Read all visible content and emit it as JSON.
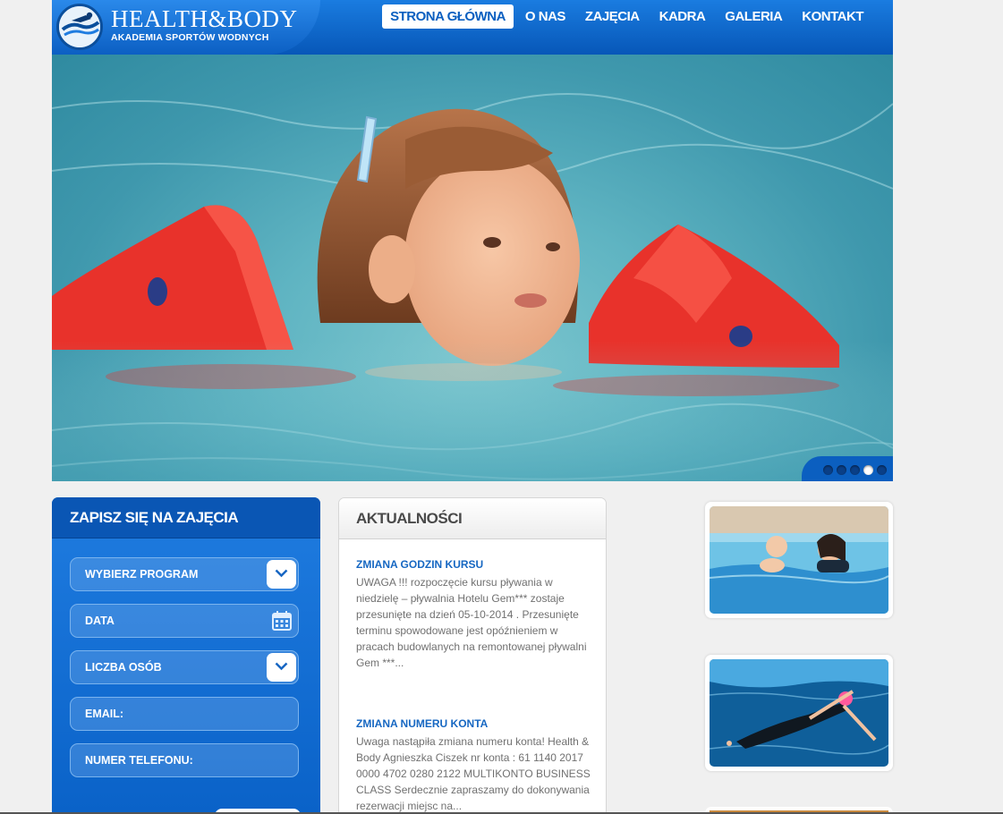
{
  "brand": {
    "title": "HEALTH&BODY",
    "subtitle": "AKADEMIA SPORTÓW WODNYCH"
  },
  "nav": {
    "items": [
      {
        "label": "STRONA GŁÓWNA",
        "active": true
      },
      {
        "label": "O NAS",
        "active": false
      },
      {
        "label": "ZAJĘCIA",
        "active": false
      },
      {
        "label": "KADRA",
        "active": false
      },
      {
        "label": "GALERIA",
        "active": false
      },
      {
        "label": "KONTAKT",
        "active": false
      }
    ]
  },
  "slider": {
    "slide_count": 5,
    "active_slide": 4
  },
  "signup": {
    "title": "ZAPISZ SIĘ NA ZAJĘCIA",
    "fields": [
      {
        "label": "WYBIERZ PROGRAM",
        "control": "dropdown"
      },
      {
        "label": "DATA",
        "control": "calendar"
      },
      {
        "label": "LICZBA OSÓB",
        "control": "dropdown"
      },
      {
        "label": "EMAIL:",
        "control": "text"
      },
      {
        "label": "NUMER TELEFONU:",
        "control": "text"
      }
    ]
  },
  "news": {
    "title": "AKTUALNOŚCI",
    "items": [
      {
        "title": "ZMIANA GODZIN KURSU",
        "body": "UWAGA !!! rozpoczęcie kursu pływania w niedzielę – pływalnia Hotelu Gem*** zostaje przesunięte na dzień 05-10-2014 . Przesunięte terminu spowodowane jest opóźnieniem w pracach budowlanych na remontowanej pływalni Gem ***..."
      },
      {
        "title": "ZMIANA NUMERU KONTA",
        "body": "Uwaga nastąpiła zmiana numeru konta! Health & Body Agnieszka Ciszek nr konta : 61 1140 2017 0000 4702 0280 2122 MULTIKONTO BUSINESS CLASS Serdecznie zapraszamy do dokonywania rezerwacji miejsc na..."
      }
    ]
  },
  "colors": {
    "brand_blue": "#0b5fc0",
    "link_blue": "#1667c2",
    "float_red": "#e8322b"
  }
}
